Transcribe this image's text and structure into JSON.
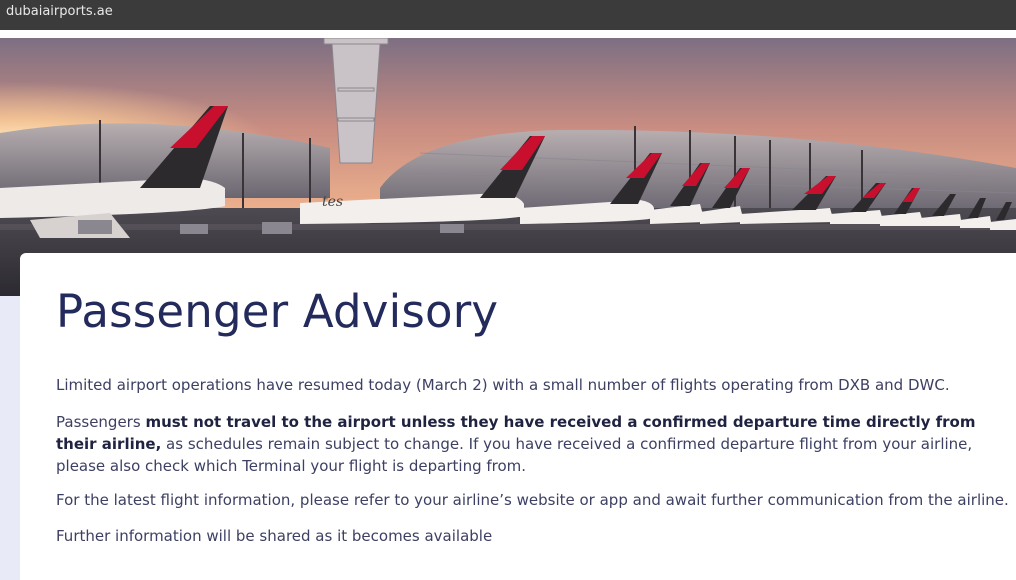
{
  "browser": {
    "url": "dubaiairports.ae"
  },
  "hero": {
    "image": "dubai-airport-emirates-aircraft-photo",
    "fuselage_text": "tes"
  },
  "advisory": {
    "title": "Passenger Advisory",
    "paragraph1": "Limited airport operations have resumed today (March 2) with a small number of flights operating from DXB and DWC.",
    "paragraph2_prefix": "Passengers ",
    "paragraph2_bold": "must not travel to the airport unless they have received a confirmed departure time directly from their airline,",
    "paragraph2_suffix": " as schedules remain subject to change. If you have received a confirmed departure flight from your airline, please also check which Terminal your flight is departing from.",
    "paragraph3": "For the latest flight information, please refer to your airline’s website or app and await further communication from the airline.",
    "paragraph4": "Further information will be shared as it becomes available"
  },
  "colors": {
    "title": "#232a5c",
    "body_text": "#3d4063",
    "page_background": "#e9eaf7",
    "browser_bar": "#3b3b3b"
  }
}
